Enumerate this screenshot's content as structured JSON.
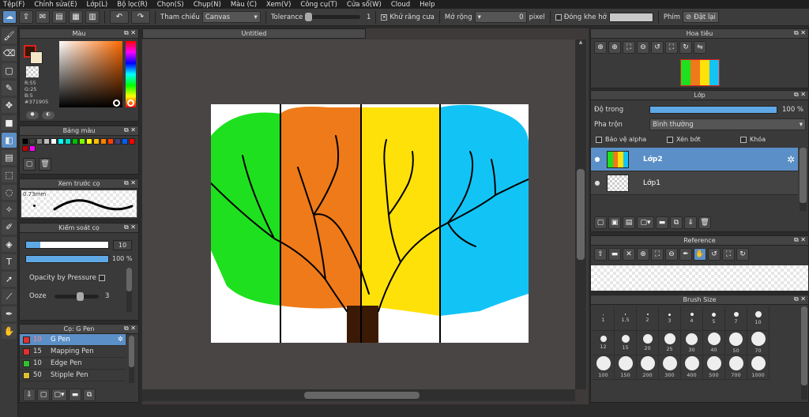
{
  "menu": [
    "Tệp(F)",
    "Chỉnh sửa(E)",
    "Lớp(L)",
    "Bộ lọc(R)",
    "Chọn(S)",
    "Chụp(N)",
    "Màu (C)",
    "Xem(V)",
    "Công cụ(T)",
    "Cửa sổ(W)",
    "Cloud",
    "Help"
  ],
  "toolbar": {
    "reference_label": "Tham chiếu",
    "reference_value": "Canvas",
    "tolerance_label": "Tolerance",
    "tolerance_value": "1",
    "antialias_label": "Khử răng cưa",
    "expand_label": "Mở rộng",
    "expand_value": "0",
    "expand_unit": "pixel",
    "gap_label": "Đóng khe hở",
    "key_label": "Phím",
    "reset_label": "Đặt lại"
  },
  "color_panel": {
    "title": "Màu",
    "r": "R:55",
    "g": "G:25",
    "b": "B:5",
    "hex": "#371905",
    "main_color": "#371905",
    "sub_color": "#f5e6c8"
  },
  "palette_panel": {
    "title": "Bảng màu",
    "colors": [
      "#000000",
      "#404040",
      "#808080",
      "#c0c0c0",
      "#ffffff",
      "#00ffff",
      "#00e0c0",
      "#00c000",
      "#80ff00",
      "#ffff00",
      "#ffc000",
      "#ff8000",
      "#ff4000",
      "#404080",
      "#0060ff",
      "#ff0000",
      "#c00000",
      "#ff00ff"
    ]
  },
  "preview_panel": {
    "title": "Xem trước cọ",
    "size_text": "0.73mm"
  },
  "brush_control": {
    "title": "Kiểm soát cọ",
    "size_value": "10",
    "opacity_value": "100 %",
    "pressure_label": "Opacity by Pressure",
    "ooze_label": "Ooze",
    "ooze_value": "3"
  },
  "pen_panel": {
    "title": "Cọ: G Pen",
    "items": [
      {
        "size": "10",
        "name": "G Pen",
        "color": "#e03030"
      },
      {
        "size": "15",
        "name": "Mapping Pen",
        "color": "#e03030"
      },
      {
        "size": "10",
        "name": "Edge Pen",
        "color": "#30c030"
      },
      {
        "size": "50",
        "name": "Stipple Pen",
        "color": "#e0c030"
      }
    ]
  },
  "document": {
    "tab_title": "Untitled"
  },
  "navigator": {
    "title": "Hoa tiêu"
  },
  "layer_panel": {
    "title": "Lớp",
    "opacity_label": "Độ trong",
    "opacity_value": "100 %",
    "blend_label": "Pha trộn",
    "blend_value": "Bình thường",
    "protect_alpha": "Bảo vệ alpha",
    "clipping": "Xén bớt",
    "lock": "Khóa",
    "layers": [
      {
        "name": "Lớp2",
        "selected": true
      },
      {
        "name": "Lớp1",
        "selected": false
      }
    ]
  },
  "reference_panel": {
    "title": "Reference"
  },
  "brush_size_panel": {
    "title": "Brush Size",
    "sizes": [
      "1",
      "1.5",
      "2",
      "3",
      "4",
      "5",
      "7",
      "10",
      "12",
      "15",
      "20",
      "25",
      "30",
      "40",
      "50",
      "70",
      "100",
      "150",
      "200",
      "300",
      "400",
      "500",
      "700",
      "1000"
    ]
  }
}
